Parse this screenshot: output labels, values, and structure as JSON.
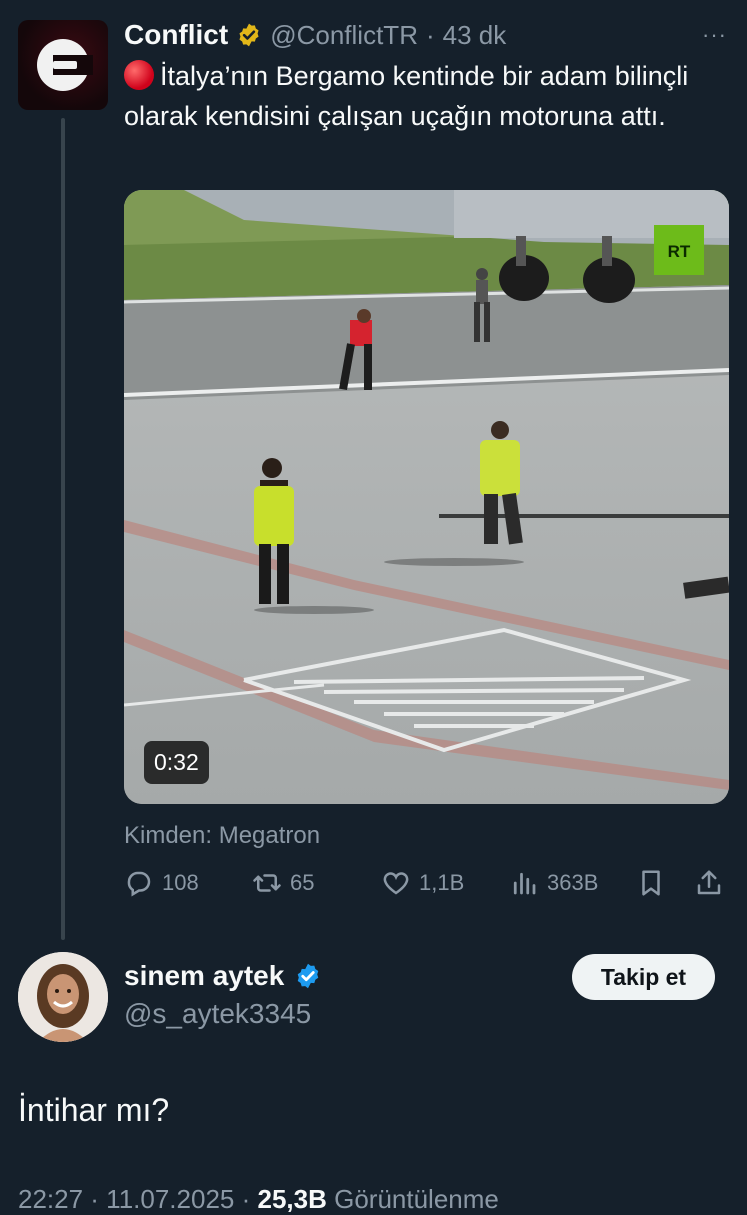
{
  "original_tweet": {
    "author_name": "Conflict",
    "handle": "@ConflictTR",
    "separator": "·",
    "time": "43 dk",
    "more": "···",
    "text": "İtalya’nın Bergamo kentinde bir adam bilinçli olarak kendisini çalışan uçağın motoruna attı.",
    "video": {
      "duration": "0:32",
      "watermark": "RT"
    },
    "source": "Kimden: Megatron",
    "stats": {
      "replies": "108",
      "retweets": "65",
      "likes": "1,1B",
      "views": "363B"
    }
  },
  "reply": {
    "author_name": "sinem aytek",
    "handle": "@s_aytek3345",
    "follow_label": "Takip et",
    "text": "İntihar mı?",
    "footer": {
      "timestamp": "22:27 · 11.07.2025 · ",
      "views": "25,3B",
      "views_label": " Görüntülenme"
    }
  },
  "colors": {
    "background": "#15202b",
    "verified_blue": "#1d9bf0",
    "verified_gold": "#e2b719",
    "muted": "#8b98a5"
  },
  "icons": [
    "more-icon",
    "verified-gold-icon",
    "red-circle-icon",
    "reply-icon",
    "retweet-icon",
    "like-icon",
    "views-icon",
    "bookmark-icon",
    "share-icon",
    "verified-blue-icon"
  ]
}
